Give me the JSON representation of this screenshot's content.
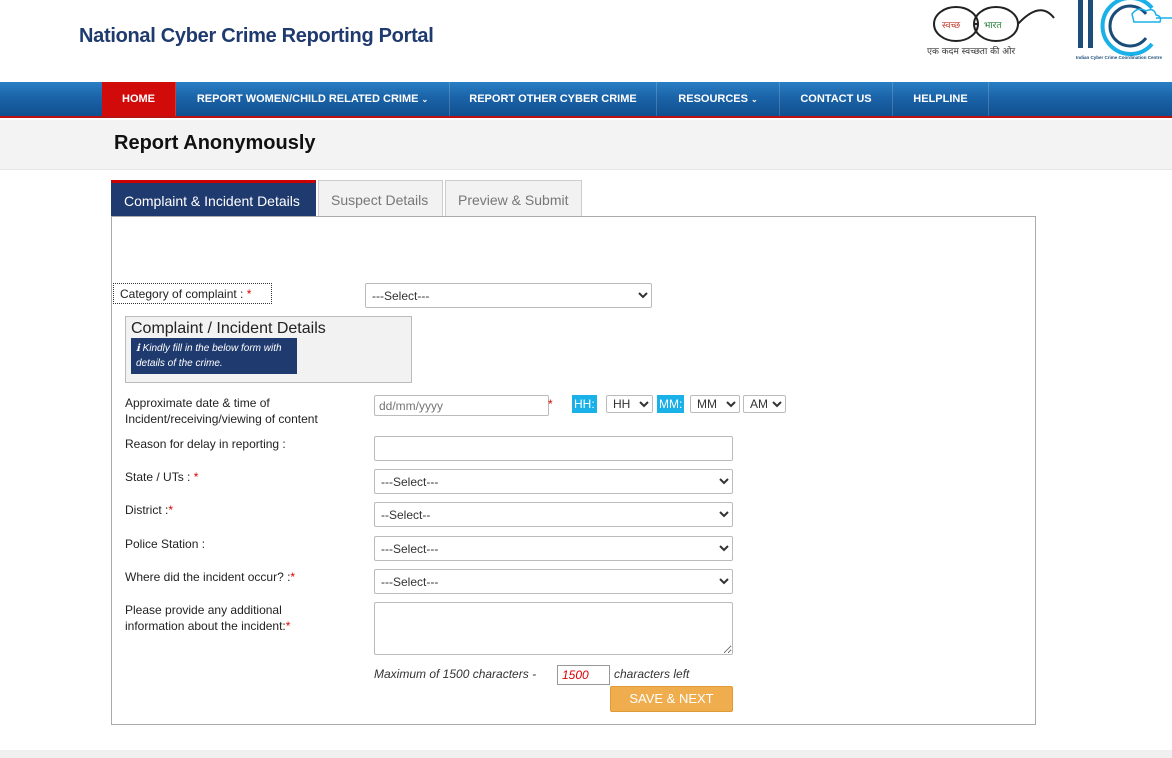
{
  "header": {
    "site_title": "National Cyber Crime Reporting Portal",
    "swachh_hindi_1": "स्वच्छ",
    "swachh_hindi_2": "भारत",
    "swachh_tagline": "एक कदम स्वच्छता की ओर",
    "i4c_logo_text": "Indian Cyber Crime Coordination Centre"
  },
  "nav": {
    "items": [
      {
        "label": "HOME"
      },
      {
        "label": "REPORT WOMEN/CHILD RELATED CRIME"
      },
      {
        "label": "REPORT OTHER CYBER CRIME"
      },
      {
        "label": "RESOURCES"
      },
      {
        "label": "CONTACT US"
      },
      {
        "label": "HELPLINE"
      }
    ],
    "caret": "⌄"
  },
  "page": {
    "title": "Report Anonymously"
  },
  "tabs": [
    {
      "label": "Complaint & Incident Details",
      "active": true
    },
    {
      "label": "Suspect Details",
      "active": false
    },
    {
      "label": "Preview & Submit",
      "active": false
    }
  ],
  "form": {
    "category": {
      "label": "Category of complaint :",
      "required_mark": "*",
      "selected": "---Select---"
    },
    "detail_box": {
      "title": "Complaint / Incident Details",
      "note_icon": "ℹ",
      "note": "Kindly fill in the below form with details of the crime."
    },
    "incident_datetime": {
      "label": "Approximate date & time of Incident/receiving/viewing of content",
      "required_mark": "*",
      "date_placeholder": "dd/mm/yyyy",
      "hh_label": "HH:",
      "hh_selected": "HH",
      "mm_label": "MM:",
      "mm_selected": "MM",
      "ampm_selected": "AM"
    },
    "delay_reason": {
      "label": "Reason for delay in reporting :",
      "value": ""
    },
    "state": {
      "label": "State / UTs :",
      "required_mark": "*",
      "selected": "---Select---"
    },
    "district": {
      "label": "District :",
      "required_mark": "*",
      "selected": "--Select--"
    },
    "police_station": {
      "label": "Police Station :",
      "selected": "---Select---"
    },
    "incident_place": {
      "label": "Where did the incident occur? :",
      "required_mark": "*",
      "selected": "---Select---"
    },
    "additional_info": {
      "label": "Please provide any additional information about the incident:",
      "required_mark": "*",
      "value": ""
    },
    "char_limit": {
      "prefix": "Maximum of 1500 characters -",
      "count": "1500",
      "suffix": "characters left"
    },
    "save_button": "SAVE & NEXT"
  },
  "colors": {
    "brand_navy": "#1f3a6e",
    "nav_blue": "#1b63a8",
    "home_red": "#d10a0a",
    "time_tag_cyan": "#1ab0e8",
    "save_orange": "#f0ad4e",
    "required_red": "#d00"
  }
}
